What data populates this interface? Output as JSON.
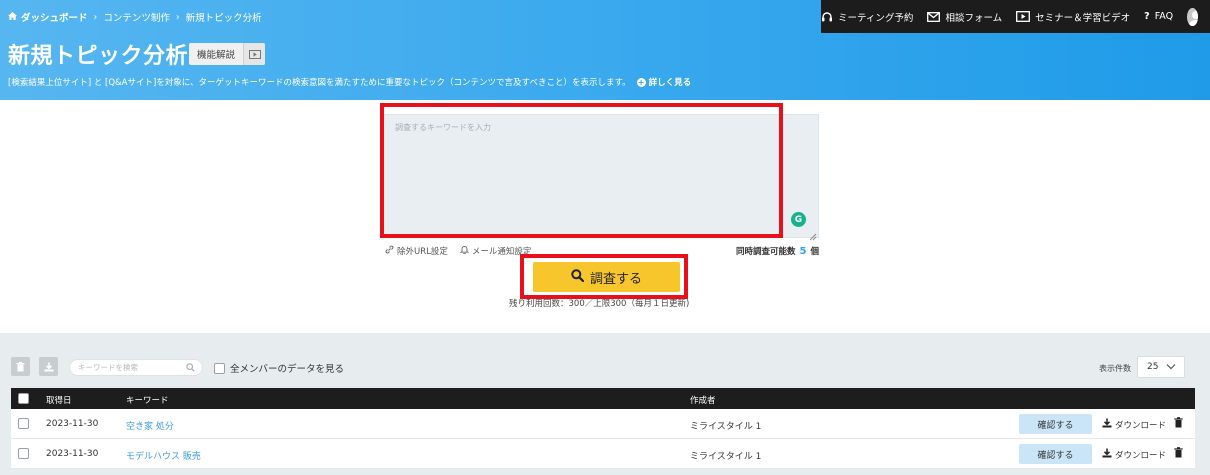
{
  "breadcrumb": {
    "home": "ダッシュボード",
    "level2": "コンテンツ制作",
    "level3": "新規トピック分析"
  },
  "topbar": {
    "meeting": "ミーティング予約",
    "consult": "相談フォーム",
    "seminar": "セミナー＆学習ビデオ",
    "faq": "FAQ"
  },
  "header": {
    "title": "新規トピック分析",
    "feature_label": "機能解説",
    "description": "[検索結果上位サイト] と [Q&Aサイト]を対象に、ターゲットキーワードの検索意図を満たすために重要なトピック（コンテンツで言及すべきこと）を表示します。",
    "more_label": "詳しく見る"
  },
  "search": {
    "placeholder": "調査するキーワードを入力",
    "exclude_url": "除外URL設定",
    "mail_notify": "メール通知設定",
    "capacity_label": "同時調査可能数",
    "capacity_value": "5",
    "capacity_unit": "個",
    "submit_label": "調査する",
    "remaining": "残り利用回数：300／上限300（毎月１日更新)"
  },
  "list": {
    "search_placeholder": "キーワードを検索",
    "all_members_label": "全メンバーのデータを見る",
    "per_page_label": "表示件数",
    "per_page_value": "25",
    "columns": {
      "date": "取得日",
      "keyword": "キーワード",
      "author": "作成者"
    },
    "rows": [
      {
        "date": "2023-11-30",
        "keyword": "空き家 処分",
        "author": "ミライスタイル 1",
        "confirm": "確認する",
        "download": "ダウンロード"
      },
      {
        "date": "2023-11-30",
        "keyword": "モデルハウス 販売",
        "author": "ミライスタイル 1",
        "confirm": "確認する",
        "download": "ダウンロード"
      }
    ]
  },
  "colors": {
    "header_gradient_start": "#56b6f0",
    "header_gradient_end": "#1f9be8",
    "topbar": "#1c1c1c",
    "primary_button": "#f7c52c",
    "highlight_box": "#e8101b",
    "link": "#3a9bd8"
  }
}
